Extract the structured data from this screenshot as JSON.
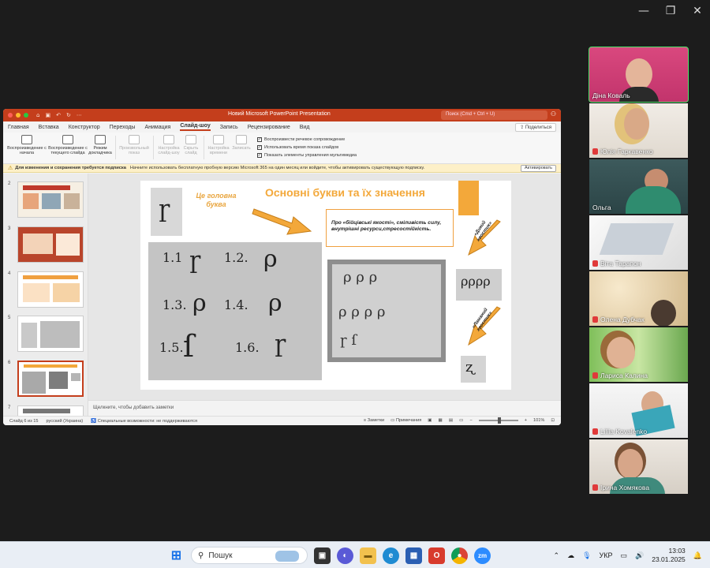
{
  "window_controls": {
    "minimize": "—",
    "restore": "❐",
    "close": "✕"
  },
  "ppt": {
    "doc_title": "Новий Microsoft PowerPoint Presentation",
    "search_placeholder": "Поиск (Cmd + Ctrl + U)",
    "tabs": [
      "Главная",
      "Вставка",
      "Конструктор",
      "Переходы",
      "Анимация",
      "Слайд-шоу",
      "Запись",
      "Рецензирование",
      "Вид"
    ],
    "active_tab": "Слайд-шоу",
    "share_label": "Поделиться",
    "ribbon": {
      "play_start": "Воспроизведение с начала",
      "play_current": "Воспроизведение с текущего слайда",
      "presenter_mode": "Режим докладчика",
      "custom_show": "Произвольный показ",
      "setup_show": "Настройка слайд-шоу",
      "hide_slide": "Скрыть слайд",
      "rehearse": "Настройка времени",
      "record": "Записать",
      "check1": "Воспроизвести речевое сопровождение",
      "check2": "Использовать время показа слайдов",
      "check3": "Показать элементы управления мультимедиа"
    },
    "notice_bold": "Для изменения и сохранения требуется подписка",
    "notice_text": "Начните использовать бесплатную пробную версию Microsoft 365 на один месяц или войдите, чтобы активировать существующую подписку.",
    "activate_label": "Активировать",
    "thumb_numbers": [
      "2",
      "3",
      "4",
      "5",
      "6",
      "7"
    ],
    "slide": {
      "title": "Основні букви та їх значення",
      "label_main": "Це головна буква",
      "textbox": "Про «бійцівські якості», сміливість силу, внутрішні ресурси,стресостійкість.",
      "arrow1": "«Дикий хвостик»",
      "arrow2": "«Ламаний хвостик»",
      "hw_11": "1.1",
      "hw_12": "1.2.",
      "hw_13": "1.3.",
      "hw_14": "1.4.",
      "hw_15": "1.5.",
      "hw_16": "1.6."
    },
    "notes_placeholder": "Щелкните, чтобы добавить заметки",
    "status": {
      "slide_of": "Слайд 6 из 15",
      "language": "русский (Украина)",
      "accessibility": "Специальные возможности: не поддерживаются",
      "notes": "Заметки",
      "comments": "Примечания",
      "zoom": "101%"
    }
  },
  "participants": [
    {
      "name": "Діна Коваль",
      "muted": false,
      "speaking": true
    },
    {
      "name": "Юлія Гаркавенко",
      "muted": true
    },
    {
      "name": "Ольга",
      "muted": false
    },
    {
      "name": "Віта Тарапон",
      "muted": true
    },
    {
      "name": "Олена Дубчак",
      "muted": true
    },
    {
      "name": "Лариса Калина",
      "muted": true
    },
    {
      "name": "Liliia Kovalenko",
      "muted": true
    },
    {
      "name": "Ірина Хомякова",
      "muted": true
    }
  ],
  "taskbar": {
    "search_placeholder": "Пошук",
    "language": "УКР",
    "time": "13:03",
    "date": "23.01.2025"
  },
  "colors": {
    "accent": "#c43e1c",
    "slide_orange": "#f3a83a",
    "speaking": "#4ee26a"
  }
}
